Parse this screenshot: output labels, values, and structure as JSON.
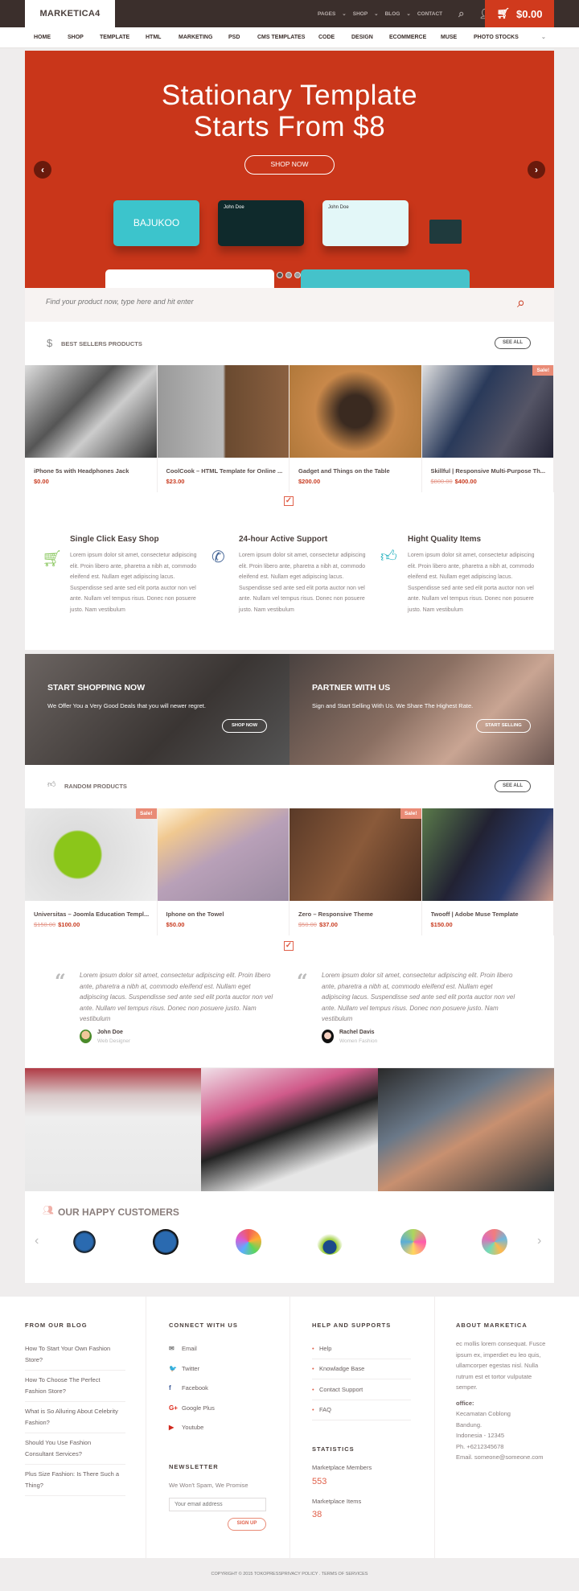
{
  "header": {
    "logo": "MARKETICA4",
    "top_links": [
      "PAGES",
      "SHOP",
      "BLOG",
      "CONTACT"
    ],
    "cart_total": "$0.00"
  },
  "nav": [
    "HOME",
    "SHOP",
    "TEMPLATE",
    "HTML",
    "MARKETING",
    "PSD",
    "CMS TEMPLATES",
    "CODE",
    "DESIGN",
    "ECOMMERCE",
    "MUSE",
    "PHOTO STOCKS"
  ],
  "hero": {
    "line1": "Stationary Template",
    "line2": "Starts From $8",
    "button": "SHOP NOW",
    "card_brand": "BAJUKOO",
    "card_name1": "John Doe",
    "card_name2": "John Doe"
  },
  "search": {
    "placeholder": "Find your product now, type here and hit enter"
  },
  "best_sellers": {
    "title": "BEST SELLERS PRODUCTS",
    "see_all": "SEE ALL",
    "products": [
      {
        "title": "iPhone 5s with Headphones Jack",
        "price": "$0.00",
        "old": "",
        "sale": false
      },
      {
        "title": "CoolCook – HTML Template for Online ...",
        "price": "$23.00",
        "old": "",
        "sale": false
      },
      {
        "title": "Gadget and Things on the Table",
        "price": "$200.00",
        "old": "",
        "sale": false
      },
      {
        "title": "Skillful | Responsive Multi-Purpose Th...",
        "price": "$400.00",
        "old": "$800.00",
        "sale": true
      }
    ]
  },
  "sale_label": "Sale!",
  "features": [
    {
      "title": "Single Click Easy Shop",
      "text": "Lorem ipsum dolor sit amet, consectetur adipiscing elit. Proin libero ante, pharetra a nibh at, commodo eleifend est. Nullam eget adipiscing lacus. Suspendisse sed ante sed elit porta auctor non vel ante. Nullam vel tempus risus. Donec non posuere justo. Nam vestibulum",
      "color": "#8cc862"
    },
    {
      "title": "24-hour Active Support",
      "text": "Lorem ipsum dolor sit amet, consectetur adipiscing elit. Proin libero ante, pharetra a nibh at, commodo eleifend est. Nullam eget adipiscing lacus. Suspendisse sed ante sed elit porta auctor non vel ante. Nullam vel tempus risus. Donec non posuere justo. Nam vestibulum",
      "color": "#4a6a9a"
    },
    {
      "title": "Hight Quality Items",
      "text": "Lorem ipsum dolor sit amet, consectetur adipiscing elit. Proin libero ante, pharetra a nibh at, commodo eleifend est. Nullam eget adipiscing lacus. Suspendisse sed ante sed elit porta auctor non vel ante. Nullam vel tempus risus. Donec non posuere justo. Nam vestibulum",
      "color": "#2ab3c0"
    }
  ],
  "banners": [
    {
      "title": "START SHOPPING NOW",
      "subtitle": "We Offer You a Very Good Deals that you will newer regret.",
      "button": "SHOP NOW"
    },
    {
      "title": "PARTNER WITH US",
      "subtitle": "Sign and Start Selling With Us. We Share The Highest Rate.",
      "button": "START SELLING"
    }
  ],
  "random_products": {
    "title": "RANDOM PRODUCTS",
    "see_all": "SEE ALL",
    "products": [
      {
        "title": "Universitas – Joomla Education Templ...",
        "price": "$100.00",
        "old": "$150.00",
        "sale": true
      },
      {
        "title": "Iphone on the Towel",
        "price": "$50.00",
        "old": "",
        "sale": false
      },
      {
        "title": "Zero – Responsive Theme",
        "price": "$37.00",
        "old": "$50.00",
        "sale": true
      },
      {
        "title": "Twooff | Adobe Muse Template",
        "price": "$150.00",
        "old": "",
        "sale": false
      }
    ]
  },
  "testimonials": [
    {
      "text": "Lorem ipsum dolor sit amet, consectetur adipiscing elit. Proin libero ante, pharetra a nibh at, commodo eleifend est. Nullam eget adipiscing lacus. Suspendisse sed ante sed elit porta auctor non vel ante. Nullam vel tempus risus. Donec non posuere justo. Nam vestibulum",
      "name": "John Doe",
      "role": "Web Designer"
    },
    {
      "text": "Lorem ipsum dolor sit amet, consectetur adipiscing elit. Proin libero ante, pharetra a nibh at, commodo eleifend est. Nullam eget adipiscing lacus. Suspendisse sed ante sed elit porta auctor non vel ante. Nullam vel tempus risus. Donec non posuere justo. Nam vestibulum",
      "name": "Rachel Davis",
      "role": "Women Fashion"
    }
  ],
  "customers": {
    "title": "OUR HAPPY CUSTOMERS"
  },
  "footer": {
    "blog": {
      "title": "FROM OUR BLOG",
      "items": [
        "How To Start Your Own Fashion Store?",
        "How To Choose The Perfect Fashion Store?",
        "What is So Alluring About Celebrity Fashion?",
        "Should You Use Fashion Consultant Services?",
        "Plus Size Fashion: Is There Such a Thing?"
      ]
    },
    "connect": {
      "title": "CONNECT WITH US",
      "items": [
        {
          "label": "Email",
          "icon": "email-icon",
          "glyph": "✉",
          "color": "#777"
        },
        {
          "label": "Twitter",
          "icon": "twitter-icon",
          "glyph": "🐦",
          "color": "#2aa8e0"
        },
        {
          "label": "Facebook",
          "icon": "facebook-icon",
          "glyph": "f",
          "color": "#3b5998"
        },
        {
          "label": "Google Plus",
          "icon": "google-plus-icon",
          "glyph": "G+",
          "color": "#dd2a1b"
        },
        {
          "label": "Youtube",
          "icon": "youtube-icon",
          "glyph": "▶",
          "color": "#d0281d"
        }
      ]
    },
    "newsletter": {
      "title": "NEWSLETTER",
      "text": "We Won't Spam, We Promise",
      "placeholder": "Your email address",
      "button": "SIGN UP"
    },
    "help": {
      "title": "HELP AND SUPPORTS",
      "items": [
        "Help",
        "Knowladge Base",
        "Contact Support",
        "FAQ"
      ]
    },
    "stats": {
      "title": "STATISTICS",
      "members_label": "Marketplace Members",
      "members": "553",
      "items_label": "Marketplace Items",
      "items": "38"
    },
    "about": {
      "title": "ABOUT MARKETICA",
      "text": "ec mollis lorem consequat. Fusce ipsum ex, imperdiet eu leo quis, ullamcorper egestas nisl. Nulla rutrum est et tortor vulputate semper.",
      "office_label": "office:",
      "lines": [
        "Kecamatan Coblong",
        "Bandung.",
        "Indonesia - 12345",
        "Ph. +6212345678",
        "Email. someone@someone.com"
      ]
    },
    "copyright": "COPYRIGHT © 2015 TOKOPRESSPRIVACY POLICY . TERMS OF SERVICES"
  },
  "colors": {
    "accent": "#c9361a",
    "dark": "#3b2f2c",
    "price": "#c83a1f"
  }
}
